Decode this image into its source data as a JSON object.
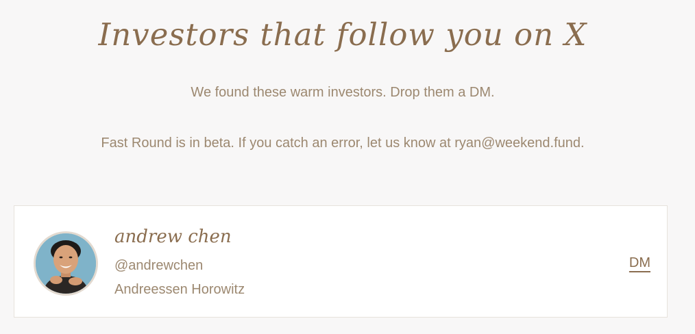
{
  "header": {
    "title": "Investors that follow you on X",
    "subtitle": "We found these warm investors. Drop them a DM.",
    "notice": "Fast Round is in beta. If you catch an error, let us know at ryan@weekend.fund."
  },
  "investors": [
    {
      "name": "andrew chen",
      "handle": "@andrewchen",
      "firm": "Andreessen Horowitz",
      "action_label": "DM",
      "avatar_icon": "person-photo"
    }
  ],
  "colors": {
    "accent": "#8a6d4f",
    "muted_text": "#9c8870",
    "background": "#f8f7f7",
    "card_background": "#ffffff"
  }
}
